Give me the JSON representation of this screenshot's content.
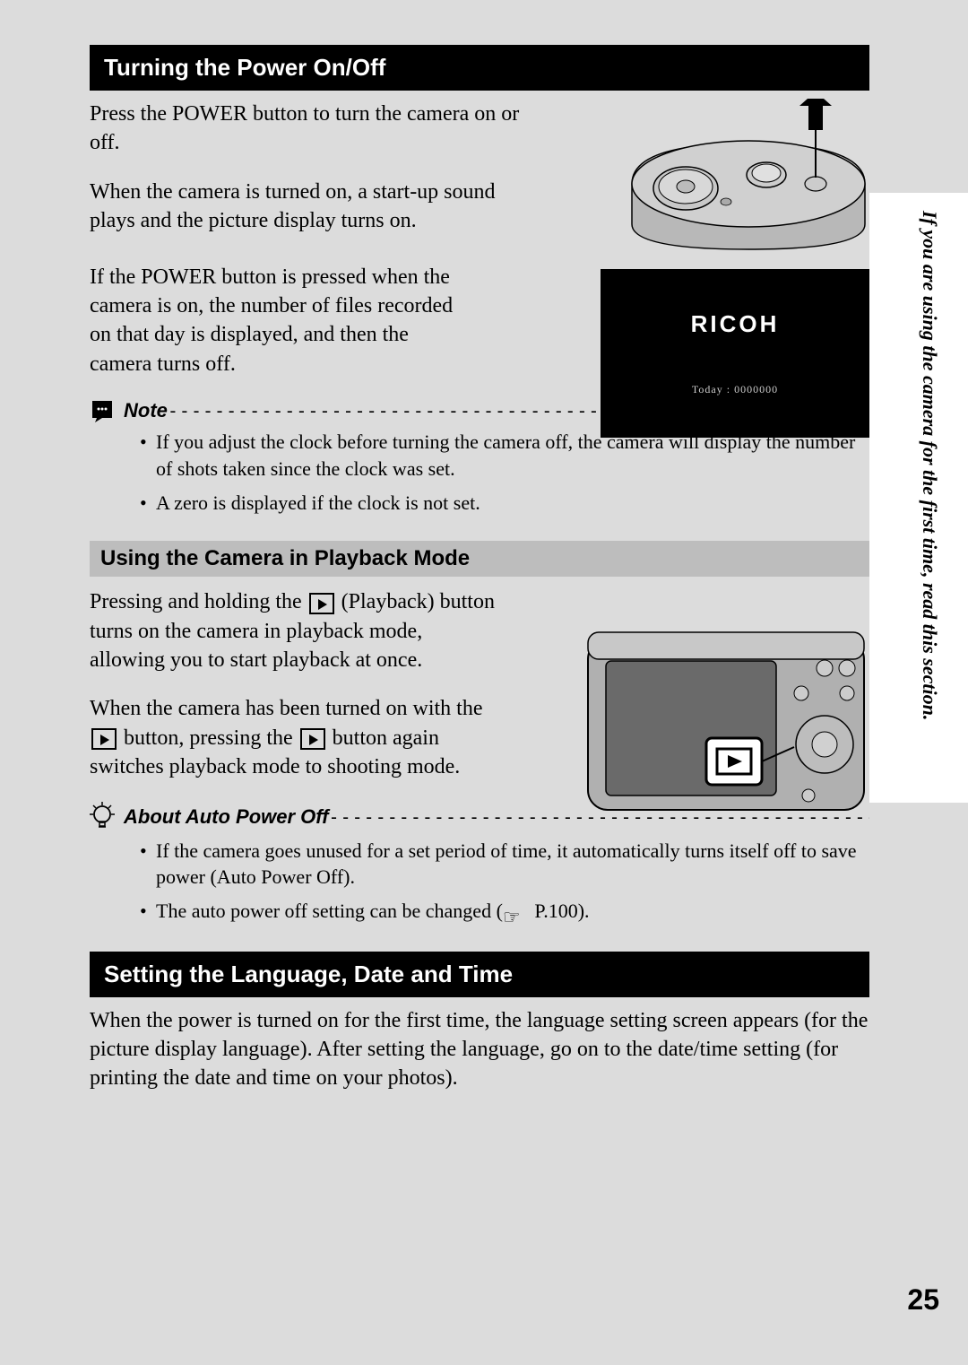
{
  "sideTab": "If you are using the camera for the first time, read this section.",
  "pageNumber": "25",
  "section1": {
    "header": "Turning the Power On/Off",
    "p1": "Press the POWER button to turn the camera on or off.",
    "p2": "When the camera is turned on, a start-up sound plays and the picture display turns on.",
    "p3": "If the POWER button is pressed when the camera is on, the number of files recorded on that day is displayed, and then the camera turns off."
  },
  "lcd": {
    "brand": "RICOH",
    "today": "Today : 0000000"
  },
  "note": {
    "label": "Note",
    "dashes": "-----------------------------------------------------------------------------------------",
    "item1": "If you adjust the clock before turning the camera off, the camera will display the number of shots taken since the clock was set.",
    "item2": "A zero is displayed if the clock is not set."
  },
  "section2": {
    "header": "Using the Camera in Playback Mode",
    "p1a": "Pressing and holding the ",
    "p1b": " (Playback) button turns on the camera in playback mode, allowing you to start playback at once.",
    "p2a": "When the camera has been turned on with the ",
    "p2b": " button, pressing the ",
    "p2c": " button again switches playback mode to shooting mode."
  },
  "about": {
    "label": "About Auto Power Off ",
    "dashes": "-----------------------------------------------------------------",
    "item1": "If the camera goes unused for a set period of time, it automatically turns itself off to save power (Auto Power Off).",
    "item2a": "The auto power off setting can be changed (",
    "item2b": " P.100)."
  },
  "section3": {
    "header": "Setting the Language, Date and Time",
    "p1": "When the power is turned on for the first time, the language setting screen appears (for the picture display language). After setting the language, go on to the date/time setting (for printing the date and time on your photos)."
  }
}
